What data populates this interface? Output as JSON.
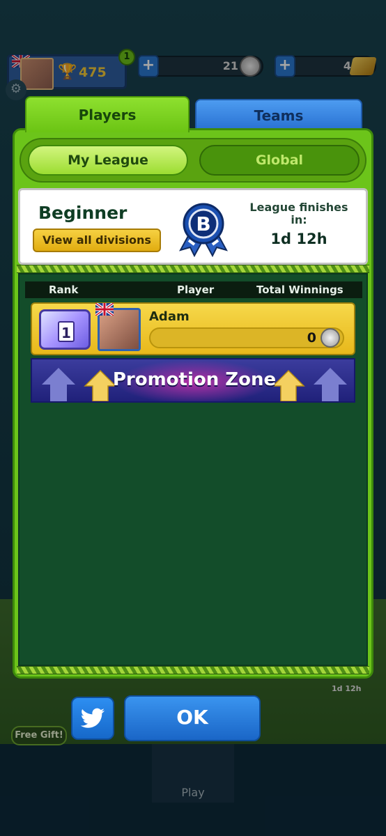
{
  "header": {
    "profile_score": "475",
    "level": "1",
    "coins": "21",
    "gold": "4"
  },
  "tabs": [
    {
      "label": "Players",
      "active": true
    },
    {
      "label": "Teams",
      "active": false
    }
  ],
  "segments": [
    {
      "label": "My League",
      "active": true
    },
    {
      "label": "Global",
      "active": false
    }
  ],
  "league": {
    "division_name": "Beginner",
    "view_all_label": "View all divisions",
    "badge_letter": "B",
    "finish_label": "League finishes in:",
    "finish_time": "1d 12h"
  },
  "table": {
    "columns": [
      "Rank",
      "Player",
      "Total Winnings"
    ],
    "rows": [
      {
        "rank": "1",
        "player": "Adam",
        "winnings": "0"
      }
    ],
    "promotion_label": "Promotion Zone"
  },
  "buttons": {
    "ok_label": "OK"
  },
  "nav": {
    "free_gift_label": "Free Gift!",
    "play_label": "Play",
    "timer_label": "1d 12h"
  },
  "colors": {
    "panel_green": "#6cc41a",
    "tab_blue": "#2b74d4",
    "row_gold": "#f6d84a",
    "promo_blue": "#2a2b8a",
    "button_blue": "#1a66c7"
  }
}
